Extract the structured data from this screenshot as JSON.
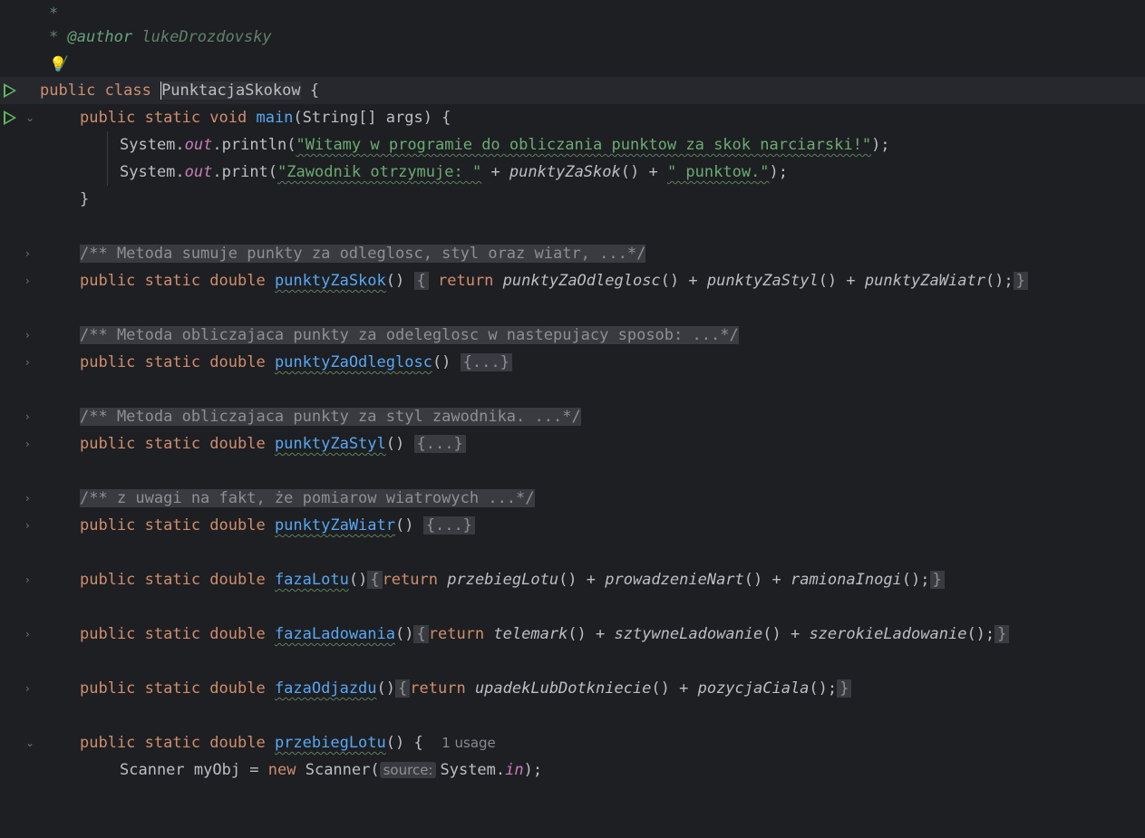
{
  "editor": {
    "language": "java",
    "lines": {
      "l1": "*",
      "l2_star": "* ",
      "l2_tag": "@author",
      "l2_value": " lukeDrozdovsky",
      "l3_end": "/",
      "class_kw": "public class ",
      "class_name": "PunktacjaSkokow",
      "class_open": " {",
      "main_kw": "public static void ",
      "main_name": "main",
      "main_sig": "(String[] args) {",
      "p1_a": "System.",
      "p1_out": "out",
      "p1_b": ".println(",
      "p1_str": "\"Witamy w programie do obliczania punktow za skok narciarski!\"",
      "p1_end": ");",
      "p2_a": "System.",
      "p2_out": "out",
      "p2_b": ".print(",
      "p2_str1": "\"Zawodnik otrzymuje: \"",
      "p2_plus1": " + ",
      "p2_call": "punktyZaSkok",
      "p2_paren": "()",
      "p2_plus2": " + ",
      "p2_str2": "\" punktow.\"",
      "p2_end": ");",
      "close_main": "}",
      "doc1": "/** Metoda sumuje punkty za odleglosc, styl oraz wiatr, ...*/",
      "m1_kw": "public static double ",
      "m1_name": "punktyZaSkok",
      "m1_paren": "()",
      "m1_body_open": "{",
      "m1_return": "return",
      "m1_c1": "punktyZaOdleglosc",
      "m1_c2": "punktyZaStyl",
      "m1_c3": "punktyZaWiatr",
      "m1_body_close": "}",
      "doc2": "/** Metoda obliczajaca punkty za odeleglosc w nastepujacy sposob: ...*/",
      "m2_kw": "public static double ",
      "m2_name": "punktyZaOdleglosc",
      "m2_paren": "()",
      "m2_fold": "{...}",
      "doc3": "/** Metoda obliczajaca punkty za styl zawodnika. ...*/",
      "m3_kw": "public static double ",
      "m3_name": "punktyZaStyl",
      "m3_paren": "()",
      "m3_fold": "{...}",
      "doc4": "/** z uwagi na fakt, że pomiarow wiatrowych ...*/",
      "m4_kw": "public static double ",
      "m4_name": "punktyZaWiatr",
      "m4_paren": "()",
      "m4_fold": "{...}",
      "m5_kw": "public static double ",
      "m5_name": "fazaLotu",
      "m5_paren": "()",
      "m5_return": "return",
      "m5_c1": "przebiegLotu",
      "m5_c2": "prowadzenieNart",
      "m5_c3": "ramionaInogi",
      "m6_kw": "public static double ",
      "m6_name": "fazaLadowania",
      "m6_paren": "()",
      "m6_return": "return",
      "m6_c1": "telemark",
      "m6_c2": "sztywneLadowanie",
      "m6_c3": "szerokieLadowanie",
      "m7_kw": "public static double ",
      "m7_name": "fazaOdjazdu",
      "m7_paren": "()",
      "m7_return": "return",
      "m7_c1": "upadekLubDotkniecie",
      "m7_c2": "pozycjaCiala",
      "m8_kw": "public static double ",
      "m8_name": "przebiegLotu",
      "m8_sig": "() {",
      "m8_hint": "1 usage",
      "s_a": "Scanner myObj = ",
      "s_new": "new",
      "s_b": " Scanner(",
      "s_inlay": "source:",
      "s_c": "System.",
      "s_in": "in",
      "s_end": ");"
    }
  },
  "colors": {
    "background": "#1e1f22",
    "keyword": "#cf8e6d",
    "string": "#6aab73",
    "function": "#56a8f5",
    "field": "#c77dba",
    "run_icon": "#5fb85f"
  },
  "icons": {
    "run": "run-icon",
    "fold_collapsed": "chevron-right-icon",
    "fold_expanded": "chevron-down-icon",
    "intention": "lightbulb-icon"
  }
}
